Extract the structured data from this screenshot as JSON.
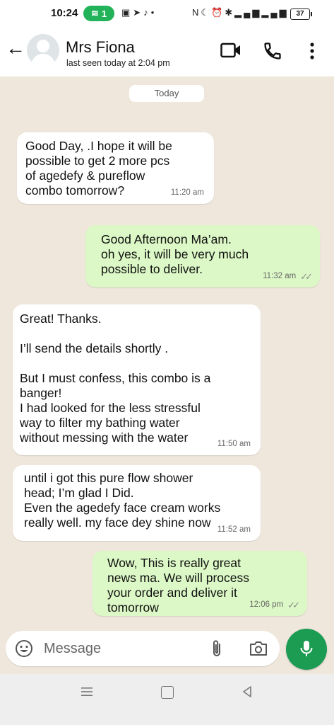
{
  "status_bar": {
    "time": "10:24",
    "hotspot_count": "1",
    "battery": "37"
  },
  "header": {
    "contact_name": "Mrs Fiona",
    "last_seen": "last seen today at 2:04 pm",
    "icons": [
      "back-arrow-icon",
      "video-call-icon",
      "voice-call-icon",
      "more-options-icon"
    ]
  },
  "chat": {
    "date_label": "Today",
    "messages": [
      {
        "direction": "incoming",
        "text": "Good Day, .I hope it will be\npossible to get 2 more pcs\nof agedefy & pureflow\n combo tomorrow?",
        "time": "11:20 am"
      },
      {
        "direction": "outgoing",
        "text": "Good Afternoon Ma’am.\noh yes, it will be very much\npossible to deliver.",
        "time": "11:32 am"
      },
      {
        "direction": "incoming",
        "text": "Great! Thanks.\n\nI’ll send the details shortly .\n\nBut I must confess, this combo is a\nbanger!\nI had looked for the less stressful\nway to filter my bathing water\nwithout messing with the water",
        "time": "11:50 am"
      },
      {
        "direction": "incoming",
        "text": "until i got this pure flow shower\nhead; I’m glad I Did.\nEven the agedefy face cream works\nreally well. my face dey shine now",
        "time": "11:52 am"
      },
      {
        "direction": "outgoing",
        "text": "Wow, This is really great\nnews ma. We will process\nyour order and deliver it\ntomorrow",
        "time": "12:06 pm"
      }
    ]
  },
  "input": {
    "placeholder": "Message"
  },
  "colors": {
    "outgoing_bubble": "#dcf8c6",
    "incoming_bubble": "#ffffff",
    "chat_background": "#efe7dc",
    "accent_green": "#1c9b52"
  }
}
